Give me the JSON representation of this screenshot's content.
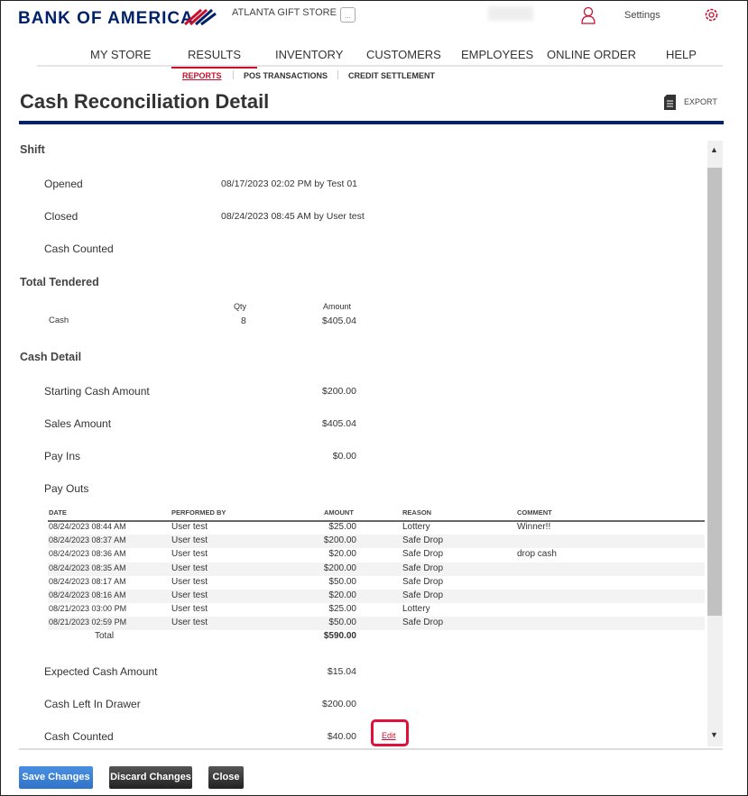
{
  "header": {
    "brand": "BANK OF AMERICA",
    "store": "ATLANTA GIFT STORE",
    "store_menu": "...",
    "settings": "Settings"
  },
  "nav": {
    "items": [
      "MY STORE",
      "RESULTS",
      "INVENTORY",
      "CUSTOMERS",
      "EMPLOYEES",
      "ONLINE ORDER",
      "HELP"
    ],
    "active": "RESULTS"
  },
  "subnav": {
    "items": [
      "REPORTS",
      "POS TRANSACTIONS",
      "CREDIT SETTLEMENT"
    ],
    "active": "REPORTS"
  },
  "page": {
    "title": "Cash Reconciliation Detail",
    "export": "EXPORT"
  },
  "shift": {
    "heading": "Shift",
    "opened_label": "Opened",
    "opened": "08/17/2023 02:02 PM by Test 01",
    "closed_label": "Closed",
    "closed": "08/24/2023 08:45 AM by User test",
    "counted_label": "Cash Counted"
  },
  "tendered": {
    "heading": "Total Tendered",
    "qty_header": "Qty",
    "amount_header": "Amount",
    "rows": [
      {
        "type": "Cash",
        "qty": "8",
        "amount": "$405.04"
      }
    ]
  },
  "cash_detail": {
    "heading": "Cash Detail",
    "starting_label": "Starting Cash Amount",
    "starting": "$200.00",
    "sales_label": "Sales Amount",
    "sales": "$405.04",
    "payins_label": "Pay Ins",
    "payins": "$0.00",
    "payouts_label": "Pay Outs",
    "expected_label": "Expected Cash Amount",
    "expected": "$15.04",
    "drawer_label": "Cash Left In Drawer",
    "drawer": "$200.00",
    "counted_label": "Cash Counted",
    "counted": "$40.00",
    "edit": "Edit"
  },
  "payouts": {
    "columns": [
      "DATE",
      "PERFORMED BY",
      "AMOUNT",
      "REASON",
      "COMMENT"
    ],
    "rows": [
      [
        "08/24/2023 08:44 AM",
        "User test",
        "$25.00",
        "Lottery",
        "Winner!!"
      ],
      [
        "08/24/2023 08:37 AM",
        "User test",
        "$200.00",
        "Safe Drop",
        ""
      ],
      [
        "08/24/2023 08:36 AM",
        "User test",
        "$20.00",
        "Safe Drop",
        "drop cash"
      ],
      [
        "08/24/2023 08:35 AM",
        "User test",
        "$200.00",
        "Safe Drop",
        ""
      ],
      [
        "08/24/2023 08:17 AM",
        "User test",
        "$50.00",
        "Safe Drop",
        ""
      ],
      [
        "08/24/2023 08:16 AM",
        "User test",
        "$20.00",
        "Safe Drop",
        ""
      ],
      [
        "08/21/2023 03:00 PM",
        "User test",
        "$25.00",
        "Lottery",
        ""
      ],
      [
        "08/21/2023 02:59 PM",
        "User test",
        "$50.00",
        "Safe Drop",
        ""
      ]
    ],
    "total_label": "Total",
    "total": "$590.00"
  },
  "buttons": {
    "save": "Save Changes",
    "discard": "Discard Changes",
    "close": "Close"
  },
  "colors": {
    "brand": "#012169",
    "accent": "#c8102e",
    "primary_button": "#3a7fd5"
  }
}
